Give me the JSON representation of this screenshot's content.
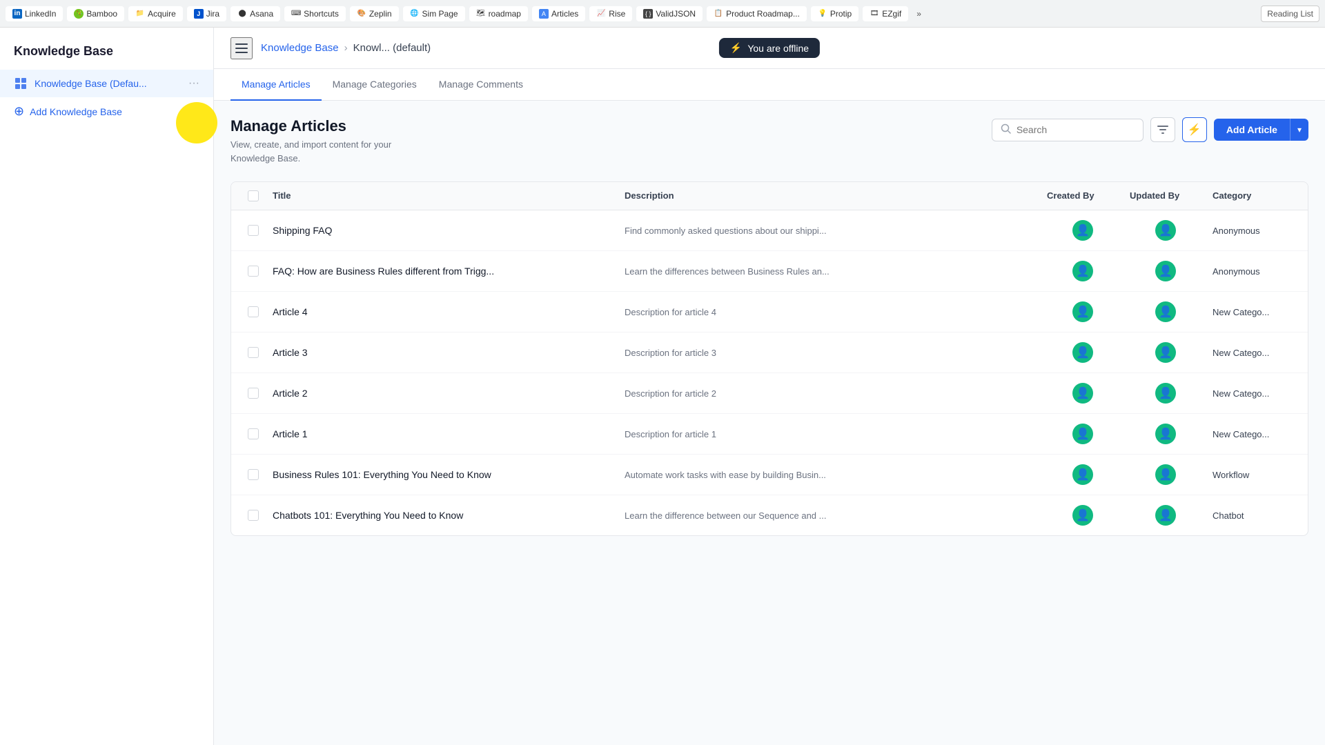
{
  "browser": {
    "tabs": [
      {
        "id": "linkedin",
        "label": "LinkedIn",
        "color": "#0a66c2"
      },
      {
        "id": "bamboo",
        "label": "Bamboo",
        "color": "#73c41e"
      },
      {
        "id": "acquire",
        "label": "Acquire",
        "color": "#444"
      },
      {
        "id": "jira",
        "label": "Jira",
        "color": "#0052cc"
      },
      {
        "id": "asana",
        "label": "Asana",
        "color": "#f06a6a"
      },
      {
        "id": "shortcuts",
        "label": "Shortcuts",
        "color": "#333"
      },
      {
        "id": "zeplin",
        "label": "Zeplin",
        "color": "#f69833"
      },
      {
        "id": "simpage",
        "label": "Sim Page",
        "color": "#444"
      },
      {
        "id": "roadmap",
        "label": "roadmap",
        "color": "#4caf50"
      },
      {
        "id": "articles",
        "label": "Articles",
        "color": "#4285f4"
      },
      {
        "id": "rise",
        "label": "Rise",
        "color": "#2196f3"
      },
      {
        "id": "validjson",
        "label": "ValidJSON",
        "color": "#444"
      },
      {
        "id": "productroadmap",
        "label": "Product Roadmap...",
        "color": "#333"
      },
      {
        "id": "protip",
        "label": "Protip",
        "color": "#555"
      },
      {
        "id": "ezgif",
        "label": "EZgif",
        "color": "#555"
      }
    ],
    "more_label": "»",
    "reading_list_label": "Reading List"
  },
  "sidebar": {
    "title": "Knowledge Base",
    "items": [
      {
        "id": "kb-default",
        "label": "Knowledge Base (Defau...",
        "active": true
      }
    ],
    "add_label": "Add Knowledge Base"
  },
  "topnav": {
    "breadcrumbs": [
      "Knowledge Base",
      ">",
      "Knowl... (default)"
    ],
    "offline_badge": "You are offline"
  },
  "tabs": [
    {
      "id": "manage-articles",
      "label": "Manage Articles",
      "active": true
    },
    {
      "id": "manage-categories",
      "label": "Manage Categories",
      "active": false
    },
    {
      "id": "manage-comments",
      "label": "Manage Comments",
      "active": false
    }
  ],
  "manage_articles": {
    "title": "Manage Articles",
    "description_line1": "View, create, and import content for your",
    "description_line2": "Knowledge Base.",
    "search_placeholder": "Search",
    "add_article_label": "Add Article",
    "table": {
      "columns": [
        "",
        "Title",
        "Description",
        "Created By",
        "Updated By",
        "Category"
      ],
      "rows": [
        {
          "title": "Shipping FAQ",
          "description": "Find commonly asked questions about our shippi...",
          "category": "Anonymous"
        },
        {
          "title": "FAQ: How are Business Rules different from Trigg...",
          "description": "Learn the differences between Business Rules an...",
          "category": "Anonymous"
        },
        {
          "title": "Article 4",
          "description": "Description for article 4",
          "category": "New Catego..."
        },
        {
          "title": "Article 3",
          "description": "Description for article 3",
          "category": "New Catego..."
        },
        {
          "title": "Article 2",
          "description": "Description for article 2",
          "category": "New Catego..."
        },
        {
          "title": "Article 1",
          "description": "Description for article 1",
          "category": "New Catego..."
        },
        {
          "title": "Business Rules 101: Everything You Need to Know",
          "description": "Automate work tasks with ease by building Busin...",
          "category": "Workflow"
        },
        {
          "title": "Chatbots 101: Everything You Need to Know",
          "description": "Learn the difference between our Sequence and ...",
          "category": "Chatbot"
        }
      ]
    }
  }
}
